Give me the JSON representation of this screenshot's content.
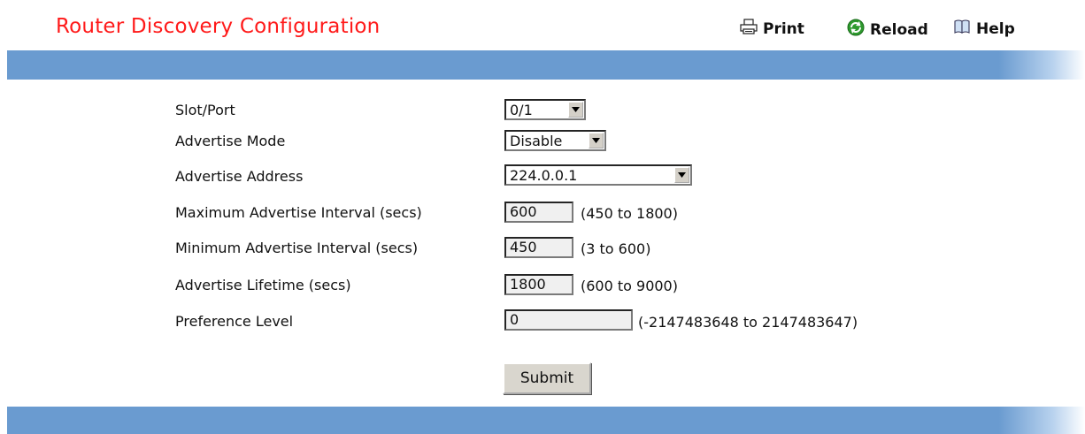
{
  "page": {
    "title": "Router Discovery Configuration"
  },
  "toolbar": {
    "print": "Print",
    "reload": "Reload",
    "help": "Help"
  },
  "form": {
    "slot_port": {
      "label": "Slot/Port",
      "value": "0/1"
    },
    "advertise_mode": {
      "label": "Advertise Mode",
      "value": "Disable"
    },
    "advertise_address": {
      "label": "Advertise Address",
      "value": "224.0.0.1"
    },
    "max_interval": {
      "label": "Maximum Advertise Interval (secs)",
      "value": "600",
      "range": "(450 to 1800)"
    },
    "min_interval": {
      "label": "Minimum Advertise Interval (secs)",
      "value": "450",
      "range": "(3 to 600)"
    },
    "lifetime": {
      "label": "Advertise Lifetime (secs)",
      "value": "1800",
      "range": "(600 to 9000)"
    },
    "preference": {
      "label": "Preference Level",
      "value": "0",
      "range": "(-2147483648 to 2147483647)"
    },
    "submit_label": "Submit"
  },
  "icons": {
    "print": "printer-icon",
    "reload": "reload-icon",
    "help": "help-book-icon"
  },
  "colors": {
    "title": "#ff1a1a",
    "bar": "#6a9bd0"
  }
}
